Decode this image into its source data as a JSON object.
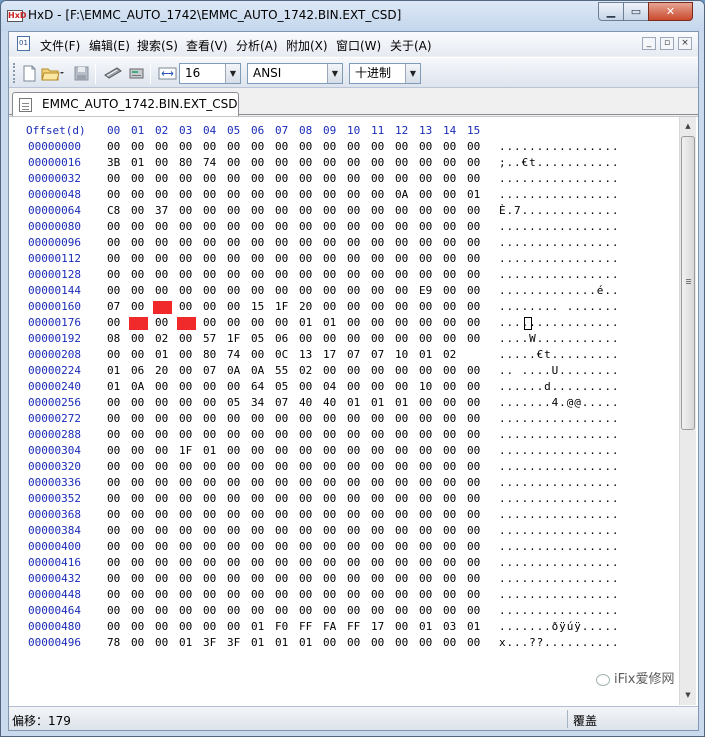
{
  "window": {
    "app_icon": "HxD",
    "title": "HxD - [F:\\EMMC_AUTO_1742\\EMMC_AUTO_1742.BIN.EXT_CSD]",
    "controls": {
      "minimize": "▁",
      "maximize": "▭",
      "close": "✕"
    }
  },
  "menubar": {
    "items": [
      "文件(F)",
      "编辑(E)",
      "搜索(S)",
      "查看(V)",
      "分析(A)",
      "附加(X)",
      "窗口(W)",
      "关于(A)"
    ],
    "mdi_controls": [
      "_",
      "▫",
      "×"
    ]
  },
  "toolbar": {
    "icons": [
      "new-file-icon",
      "open-folder-icon",
      "save-icon",
      "ram-editor-icon",
      "disk-editor-icon",
      "bytes-per-row-icon"
    ],
    "bytes_per_row": "16",
    "charset": "ANSI",
    "offset_base": "十进制"
  },
  "tab": {
    "label": "EMMC_AUTO_1742.BIN.EXT_CSD"
  },
  "editor": {
    "offset_header": "Offset(d)",
    "columns": [
      "00",
      "01",
      "02",
      "03",
      "04",
      "05",
      "06",
      "07",
      "08",
      "09",
      "10",
      "11",
      "12",
      "13",
      "14",
      "15"
    ],
    "rows": [
      {
        "offset": "00000000",
        "hex": [
          "00",
          "00",
          "00",
          "00",
          "00",
          "00",
          "00",
          "00",
          "00",
          "00",
          "00",
          "00",
          "00",
          "00",
          "00",
          "00"
        ],
        "ascii": "................"
      },
      {
        "offset": "00000016",
        "hex": [
          "3B",
          "01",
          "00",
          "80",
          "74",
          "00",
          "00",
          "00",
          "00",
          "00",
          "00",
          "00",
          "00",
          "00",
          "00",
          "00"
        ],
        "ascii": ";..€t..........."
      },
      {
        "offset": "00000032",
        "hex": [
          "00",
          "00",
          "00",
          "00",
          "00",
          "00",
          "00",
          "00",
          "00",
          "00",
          "00",
          "00",
          "00",
          "00",
          "00",
          "00"
        ],
        "ascii": "................"
      },
      {
        "offset": "00000048",
        "hex": [
          "00",
          "00",
          "00",
          "00",
          "00",
          "00",
          "00",
          "00",
          "00",
          "00",
          "00",
          "00",
          "0A",
          "00",
          "00",
          "01"
        ],
        "ascii": "................"
      },
      {
        "offset": "00000064",
        "hex": [
          "C8",
          "00",
          "37",
          "00",
          "00",
          "00",
          "00",
          "00",
          "00",
          "00",
          "00",
          "00",
          "00",
          "00",
          "00",
          "00"
        ],
        "ascii": "È.7............."
      },
      {
        "offset": "00000080",
        "hex": [
          "00",
          "00",
          "00",
          "00",
          "00",
          "00",
          "00",
          "00",
          "00",
          "00",
          "00",
          "00",
          "00",
          "00",
          "00",
          "00"
        ],
        "ascii": "................"
      },
      {
        "offset": "00000096",
        "hex": [
          "00",
          "00",
          "00",
          "00",
          "00",
          "00",
          "00",
          "00",
          "00",
          "00",
          "00",
          "00",
          "00",
          "00",
          "00",
          "00"
        ],
        "ascii": "................"
      },
      {
        "offset": "00000112",
        "hex": [
          "00",
          "00",
          "00",
          "00",
          "00",
          "00",
          "00",
          "00",
          "00",
          "00",
          "00",
          "00",
          "00",
          "00",
          "00",
          "00"
        ],
        "ascii": "................"
      },
      {
        "offset": "00000128",
        "hex": [
          "00",
          "00",
          "00",
          "00",
          "00",
          "00",
          "00",
          "00",
          "00",
          "00",
          "00",
          "00",
          "00",
          "00",
          "00",
          "00"
        ],
        "ascii": "................"
      },
      {
        "offset": "00000144",
        "hex": [
          "00",
          "00",
          "00",
          "00",
          "00",
          "00",
          "00",
          "00",
          "00",
          "00",
          "00",
          "00",
          "00",
          "E9",
          "00",
          "00"
        ],
        "ascii": ".............é.."
      },
      {
        "offset": "00000160",
        "hex": [
          "07",
          "00",
          "",
          "00",
          "00",
          "00",
          "15",
          "1F",
          "20",
          "00",
          "00",
          "00",
          "00",
          "00",
          "00",
          "00"
        ],
        "ascii": "........ ......."
      },
      {
        "offset": "00000176",
        "hex": [
          "00",
          "",
          "00",
          "",
          "00",
          "00",
          "00",
          "00",
          "01",
          "01",
          "00",
          "00",
          "00",
          "00",
          "00",
          "00"
        ],
        "ascii": "................"
      },
      {
        "offset": "00000192",
        "hex": [
          "08",
          "00",
          "02",
          "00",
          "57",
          "1F",
          "05",
          "06",
          "00",
          "00",
          "00",
          "00",
          "00",
          "00",
          "00",
          "00"
        ],
        "ascii": "....W..........."
      },
      {
        "offset": "00000208",
        "hex": [
          "00",
          "00",
          "01",
          "00",
          "80",
          "74",
          "00",
          "0C",
          "13",
          "17",
          "07",
          "07",
          "10",
          "01",
          "02"
        ],
        "ascii": ".....€t........."
      },
      {
        "offset": "00000224",
        "hex": [
          "01",
          "06",
          "20",
          "00",
          "07",
          "0A",
          "0A",
          "55",
          "02",
          "00",
          "00",
          "00",
          "00",
          "00",
          "00",
          "00"
        ],
        "ascii": ".. ....U........"
      },
      {
        "offset": "00000240",
        "hex": [
          "01",
          "0A",
          "00",
          "00",
          "00",
          "00",
          "64",
          "05",
          "00",
          "04",
          "00",
          "00",
          "00",
          "10",
          "00",
          "00"
        ],
        "ascii": "......d........."
      },
      {
        "offset": "00000256",
        "hex": [
          "00",
          "00",
          "00",
          "00",
          "00",
          "05",
          "34",
          "07",
          "40",
          "40",
          "01",
          "01",
          "01",
          "00",
          "00",
          "00"
        ],
        "ascii": ".......4.@@....."
      },
      {
        "offset": "00000272",
        "hex": [
          "00",
          "00",
          "00",
          "00",
          "00",
          "00",
          "00",
          "00",
          "00",
          "00",
          "00",
          "00",
          "00",
          "00",
          "00",
          "00"
        ],
        "ascii": "................"
      },
      {
        "offset": "00000288",
        "hex": [
          "00",
          "00",
          "00",
          "00",
          "00",
          "00",
          "00",
          "00",
          "00",
          "00",
          "00",
          "00",
          "00",
          "00",
          "00",
          "00"
        ],
        "ascii": "................"
      },
      {
        "offset": "00000304",
        "hex": [
          "00",
          "00",
          "00",
          "1F",
          "01",
          "00",
          "00",
          "00",
          "00",
          "00",
          "00",
          "00",
          "00",
          "00",
          "00",
          "00"
        ],
        "ascii": "................"
      },
      {
        "offset": "00000320",
        "hex": [
          "00",
          "00",
          "00",
          "00",
          "00",
          "00",
          "00",
          "00",
          "00",
          "00",
          "00",
          "00",
          "00",
          "00",
          "00",
          "00"
        ],
        "ascii": "................"
      },
      {
        "offset": "00000336",
        "hex": [
          "00",
          "00",
          "00",
          "00",
          "00",
          "00",
          "00",
          "00",
          "00",
          "00",
          "00",
          "00",
          "00",
          "00",
          "00",
          "00"
        ],
        "ascii": "................"
      },
      {
        "offset": "00000352",
        "hex": [
          "00",
          "00",
          "00",
          "00",
          "00",
          "00",
          "00",
          "00",
          "00",
          "00",
          "00",
          "00",
          "00",
          "00",
          "00",
          "00"
        ],
        "ascii": "................"
      },
      {
        "offset": "00000368",
        "hex": [
          "00",
          "00",
          "00",
          "00",
          "00",
          "00",
          "00",
          "00",
          "00",
          "00",
          "00",
          "00",
          "00",
          "00",
          "00",
          "00"
        ],
        "ascii": "................"
      },
      {
        "offset": "00000384",
        "hex": [
          "00",
          "00",
          "00",
          "00",
          "00",
          "00",
          "00",
          "00",
          "00",
          "00",
          "00",
          "00",
          "00",
          "00",
          "00",
          "00"
        ],
        "ascii": "................"
      },
      {
        "offset": "00000400",
        "hex": [
          "00",
          "00",
          "00",
          "00",
          "00",
          "00",
          "00",
          "00",
          "00",
          "00",
          "00",
          "00",
          "00",
          "00",
          "00",
          "00"
        ],
        "ascii": "................"
      },
      {
        "offset": "00000416",
        "hex": [
          "00",
          "00",
          "00",
          "00",
          "00",
          "00",
          "00",
          "00",
          "00",
          "00",
          "00",
          "00",
          "00",
          "00",
          "00",
          "00"
        ],
        "ascii": "................"
      },
      {
        "offset": "00000432",
        "hex": [
          "00",
          "00",
          "00",
          "00",
          "00",
          "00",
          "00",
          "00",
          "00",
          "00",
          "00",
          "00",
          "00",
          "00",
          "00",
          "00"
        ],
        "ascii": "................"
      },
      {
        "offset": "00000448",
        "hex": [
          "00",
          "00",
          "00",
          "00",
          "00",
          "00",
          "00",
          "00",
          "00",
          "00",
          "00",
          "00",
          "00",
          "00",
          "00",
          "00"
        ],
        "ascii": "................"
      },
      {
        "offset": "00000464",
        "hex": [
          "00",
          "00",
          "00",
          "00",
          "00",
          "00",
          "00",
          "00",
          "00",
          "00",
          "00",
          "00",
          "00",
          "00",
          "00",
          "00"
        ],
        "ascii": "................"
      },
      {
        "offset": "00000480",
        "hex": [
          "00",
          "00",
          "00",
          "00",
          "00",
          "00",
          "01",
          "F0",
          "FF",
          "FA",
          "FF",
          "17",
          "00",
          "01",
          "03",
          "01"
        ],
        "ascii": ".......ðÿúÿ....."
      },
      {
        "offset": "00000496",
        "hex": [
          "78",
          "00",
          "00",
          "01",
          "3F",
          "3F",
          "01",
          "01",
          "01",
          "00",
          "00",
          "00",
          "00",
          "00",
          "00",
          "00"
        ],
        "ascii": "x...??.........."
      }
    ]
  },
  "statusbar": {
    "offset_label": "偏移：",
    "offset_value": "179",
    "mode": "覆盖"
  },
  "watermark": {
    "text": "iFix爱修网"
  }
}
